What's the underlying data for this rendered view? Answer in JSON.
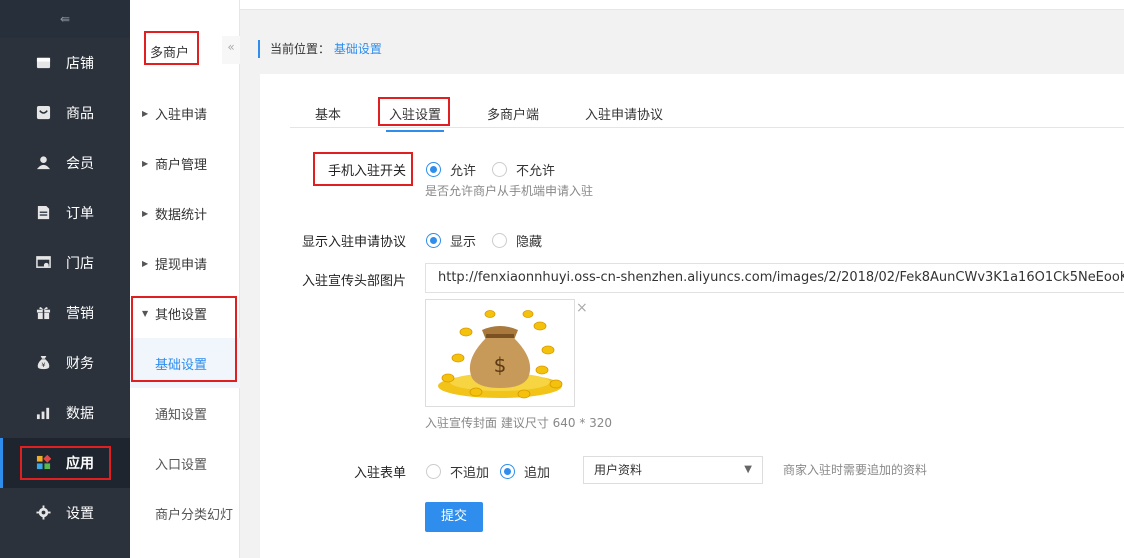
{
  "sidebar": {
    "items": [
      {
        "label": "店铺",
        "icon": "shop-icon"
      },
      {
        "label": "商品",
        "icon": "goods-icon"
      },
      {
        "label": "会员",
        "icon": "member-icon"
      },
      {
        "label": "订单",
        "icon": "order-icon"
      },
      {
        "label": "门店",
        "icon": "store-icon"
      },
      {
        "label": "营销",
        "icon": "gift-icon"
      },
      {
        "label": "财务",
        "icon": "moneybag-icon"
      },
      {
        "label": "数据",
        "icon": "bar-chart-icon"
      },
      {
        "label": "应用",
        "icon": "apps-icon"
      },
      {
        "label": "设置",
        "icon": "gear-icon"
      }
    ],
    "active_index": 8
  },
  "subnav": {
    "title": "多商户",
    "collapse": "«",
    "items": [
      "入驻申请",
      "商户管理",
      "数据统计",
      "提现申请",
      "其他设置"
    ],
    "sub_items": [
      "基础设置",
      "通知设置",
      "入口设置",
      "商户分类幻灯"
    ],
    "active_sub": "基础设置"
  },
  "breadcrumb": {
    "prefix": "当前位置：",
    "current": "基础设置"
  },
  "tabs": [
    "基本",
    "入驻设置",
    "多商户端",
    "入驻申请协议"
  ],
  "form": {
    "mobile_switch": {
      "label": "手机入驻开关",
      "options": [
        "允许",
        "不允许"
      ],
      "selected": "允许",
      "help": "是否允许商户从手机端申请入驻"
    },
    "show_agreement": {
      "label": "显示入驻申请协议",
      "options": [
        "显示",
        "隐藏"
      ],
      "selected": "显示"
    },
    "banner_image": {
      "label": "入驻宣传头部图片",
      "url": "http://fenxiaonnhuyi.oss-cn-shenzhen.aliyuncs.com/images/2/2018/02/Fek8AunCWv3K1a16O1Ck5NeEooK8zV.jpg",
      "help": "入驻宣传封面 建议尺寸 640 * 320",
      "remove": "×"
    },
    "apply_form": {
      "label": "入驻表单",
      "options": [
        "不追加",
        "追加"
      ],
      "selected": "追加",
      "select_value": "用户资料",
      "help": "商家入驻时需要追加的资料"
    },
    "submit_label": "提交"
  },
  "colors": {
    "accent": "#2e8ded",
    "sidebar_bg": "#2b323c",
    "annotation_red": "#e02020"
  }
}
